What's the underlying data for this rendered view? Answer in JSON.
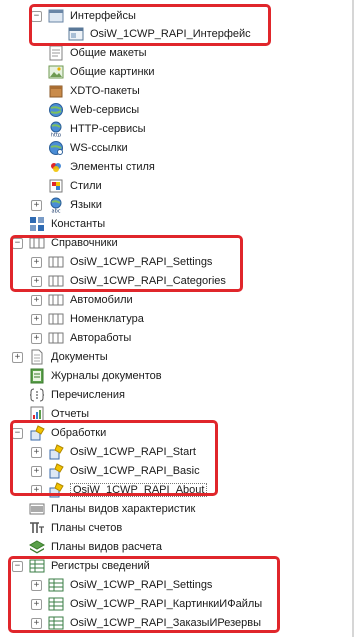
{
  "tree": {
    "items": [
      {
        "label": "Интерфейсы",
        "icon": "interface-folder-icon",
        "toggle": "−"
      },
      {
        "label": "OsiW_1CWP_RAPI_Интерфейс",
        "icon": "interface-icon"
      },
      {
        "label": "Общие макеты",
        "icon": "layout-icon"
      },
      {
        "label": "Общие картинки",
        "icon": "picture-icon"
      },
      {
        "label": "XDTO-пакеты",
        "icon": "xdto-icon"
      },
      {
        "label": "Web-сервисы",
        "icon": "web-service-icon"
      },
      {
        "label": "HTTP-сервисы",
        "icon": "http-service-icon",
        "badge": "http"
      },
      {
        "label": "WS-ссылки",
        "icon": "ws-link-icon"
      },
      {
        "label": "Элементы стиля",
        "icon": "style-element-icon"
      },
      {
        "label": "Стили",
        "icon": "style-icon"
      },
      {
        "label": "Языки",
        "icon": "language-icon",
        "toggle": "+",
        "badge": "abc"
      },
      {
        "label": "Константы",
        "icon": "constant-icon"
      },
      {
        "label": "Справочники",
        "icon": "catalog-icon",
        "toggle": "−"
      },
      {
        "label": "OsiW_1CWP_RAPI_Settings",
        "icon": "catalog-item-icon",
        "toggle": "+"
      },
      {
        "label": "OsiW_1CWP_RAPI_Categories",
        "icon": "catalog-item-icon",
        "toggle": "+"
      },
      {
        "label": "Автомобили",
        "icon": "catalog-item-icon",
        "toggle": "+"
      },
      {
        "label": "Номенклатура",
        "icon": "catalog-item-icon",
        "toggle": "+"
      },
      {
        "label": "Автоработы",
        "icon": "catalog-item-icon",
        "toggle": "+"
      },
      {
        "label": "Документы",
        "icon": "document-icon",
        "toggle": "+"
      },
      {
        "label": "Журналы документов",
        "icon": "journal-icon"
      },
      {
        "label": "Перечисления",
        "icon": "enumeration-icon"
      },
      {
        "label": "Отчеты",
        "icon": "report-icon"
      },
      {
        "label": "Обработки",
        "icon": "data-processor-icon",
        "toggle": "−"
      },
      {
        "label": "OsiW_1CWP_RAPI_Start",
        "icon": "data-processor-item-icon",
        "toggle": "+"
      },
      {
        "label": "OsiW_1CWP_RAPI_Basic",
        "icon": "data-processor-item-icon",
        "toggle": "+"
      },
      {
        "label": "OsiW_1CWP_RAPI_About",
        "icon": "data-processor-item-icon",
        "toggle": "+"
      },
      {
        "label": "Планы видов характеристик",
        "icon": "chart-of-characteristics-icon"
      },
      {
        "label": "Планы счетов",
        "icon": "chart-of-accounts-icon"
      },
      {
        "label": "Планы видов расчета",
        "icon": "chart-of-calculation-icon"
      },
      {
        "label": "Регистры сведений",
        "icon": "information-register-icon",
        "toggle": "−"
      },
      {
        "label": "OsiW_1CWP_RAPI_Settings",
        "icon": "register-item-icon",
        "toggle": "+"
      },
      {
        "label": "OsiW_1CWP_RAPI_КартинкиИФайлы",
        "icon": "register-item-icon",
        "toggle": "+"
      },
      {
        "label": "OsiW_1CWP_RAPI_ЗаказыИРезервы",
        "icon": "register-item-icon",
        "toggle": "+"
      }
    ]
  },
  "colors": {
    "highlight": "#e0262b",
    "catalog": "#6b6b6b",
    "processor_yellow": "#f2c300",
    "register_green": "#3a7d44"
  }
}
